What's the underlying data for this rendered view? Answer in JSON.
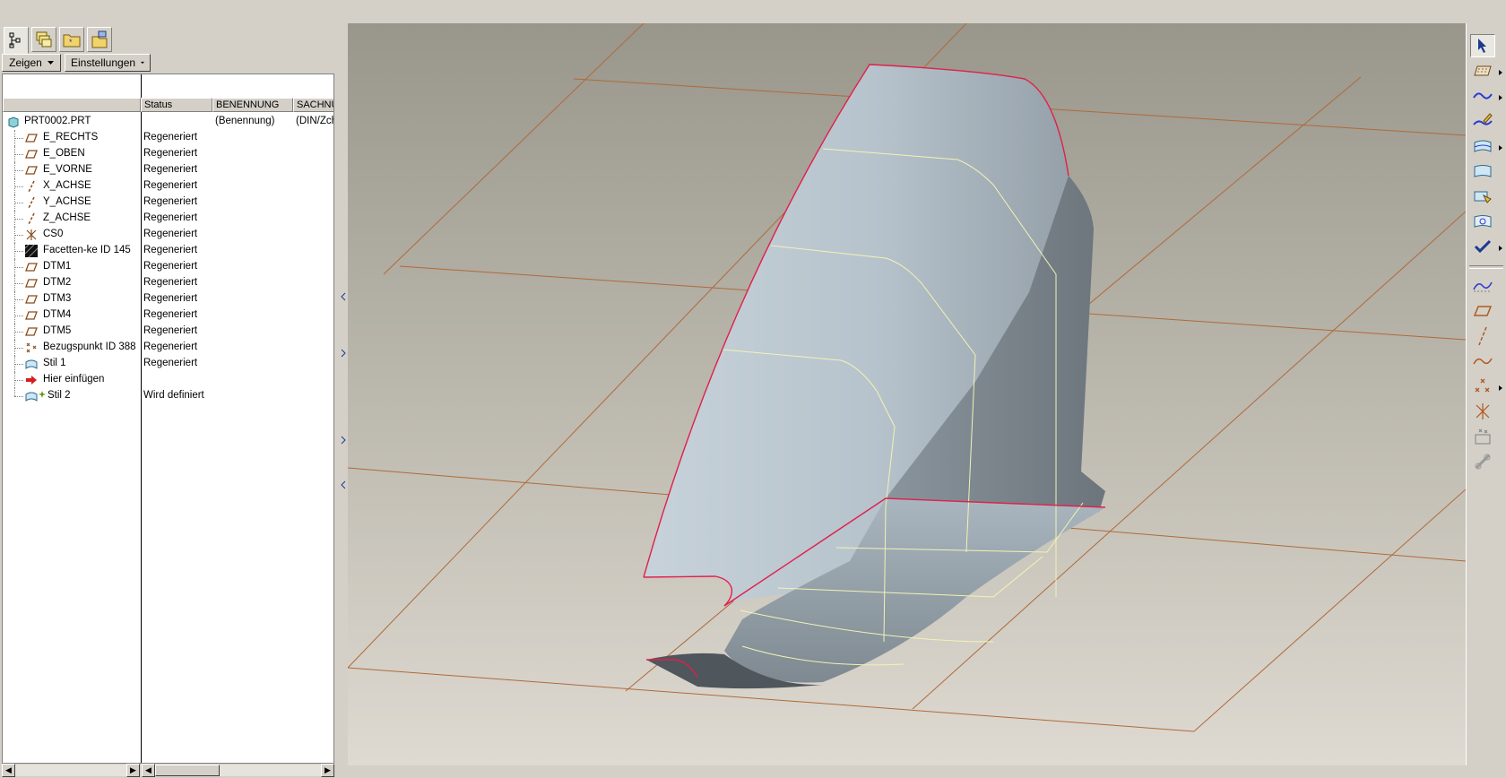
{
  "tabs": [
    {
      "icon": "model-tree-icon"
    },
    {
      "icon": "layer-tree-icon"
    },
    {
      "icon": "folder-browser-icon"
    },
    {
      "icon": "favorites-icon"
    }
  ],
  "toolbar": {
    "show_label": "Zeigen",
    "settings_label": "Einstellungen"
  },
  "columns": {
    "status": "Status",
    "benennung": "BENENNUNG",
    "sachnummer": "SACHNU"
  },
  "tree": [
    {
      "name": "PRT0002.PRT",
      "status": "",
      "benennung": "(Benennung)",
      "sachnummer": "(DIN/Zch",
      "icon": "part-icon"
    },
    {
      "name": "E_RECHTS",
      "status": "Regeneriert",
      "icon": "datum-plane-icon"
    },
    {
      "name": "E_OBEN",
      "status": "Regeneriert",
      "icon": "datum-plane-icon"
    },
    {
      "name": "E_VORNE",
      "status": "Regeneriert",
      "icon": "datum-plane-icon"
    },
    {
      "name": "X_ACHSE",
      "status": "Regeneriert",
      "icon": "datum-axis-icon"
    },
    {
      "name": "Y_ACHSE",
      "status": "Regeneriert",
      "icon": "datum-axis-icon"
    },
    {
      "name": "Z_ACHSE",
      "status": "Regeneriert",
      "icon": "datum-axis-icon"
    },
    {
      "name": "CS0",
      "status": "Regeneriert",
      "icon": "coordinate-system-icon"
    },
    {
      "name": "Facetten-ke ID 145",
      "status": "Regeneriert",
      "icon": "facet-feature-icon"
    },
    {
      "name": "DTM1",
      "status": "Regeneriert",
      "icon": "datum-plane-icon"
    },
    {
      "name": "DTM2",
      "status": "Regeneriert",
      "icon": "datum-plane-icon"
    },
    {
      "name": "DTM3",
      "status": "Regeneriert",
      "icon": "datum-plane-icon"
    },
    {
      "name": "DTM4",
      "status": "Regeneriert",
      "icon": "datum-plane-icon"
    },
    {
      "name": "DTM5",
      "status": "Regeneriert",
      "icon": "datum-plane-icon"
    },
    {
      "name": "Bezugspunkt ID 388",
      "status": "Regeneriert",
      "icon": "datum-point-icon"
    },
    {
      "name": "Stil 1",
      "status": "Regeneriert",
      "icon": "style-feature-icon"
    },
    {
      "name": "Hier einfügen",
      "status": "",
      "icon": "insert-here-arrow-icon"
    },
    {
      "name": "Stil 2",
      "status": "Wird definiert",
      "icon": "style-feature-active-icon"
    }
  ],
  "right_toolbar": [
    {
      "icon": "select-arrow-icon",
      "selected": true
    },
    {
      "icon": "sketch-plane-icon"
    },
    {
      "icon": "curve-icon"
    },
    {
      "icon": "edit-curve-icon"
    },
    {
      "icon": "surface-icon"
    },
    {
      "icon": "surface-connect-icon"
    },
    {
      "icon": "surface-trim-icon"
    },
    {
      "icon": "surface-edit-icon"
    },
    {
      "icon": "done-checkmark-icon"
    },
    {
      "icon": "datum-display-icon"
    },
    {
      "icon": "datum-plane-tool-icon"
    },
    {
      "icon": "datum-axis-tool-icon"
    },
    {
      "icon": "datum-curve-tool-icon"
    },
    {
      "icon": "datum-point-tool-icon"
    },
    {
      "icon": "coordinate-system-tool-icon"
    },
    {
      "icon": "analysis-icon"
    },
    {
      "icon": "disabled-tool-icon"
    }
  ],
  "colors": {
    "viewport_top": "#99968b",
    "viewport_bottom": "#dedad1",
    "grid_line": "#b06a3a",
    "surface": "#b7c3cc",
    "boundary": "#e0204a",
    "isoline": "#f1f3b4",
    "checkmark": "#1a3a8f"
  }
}
